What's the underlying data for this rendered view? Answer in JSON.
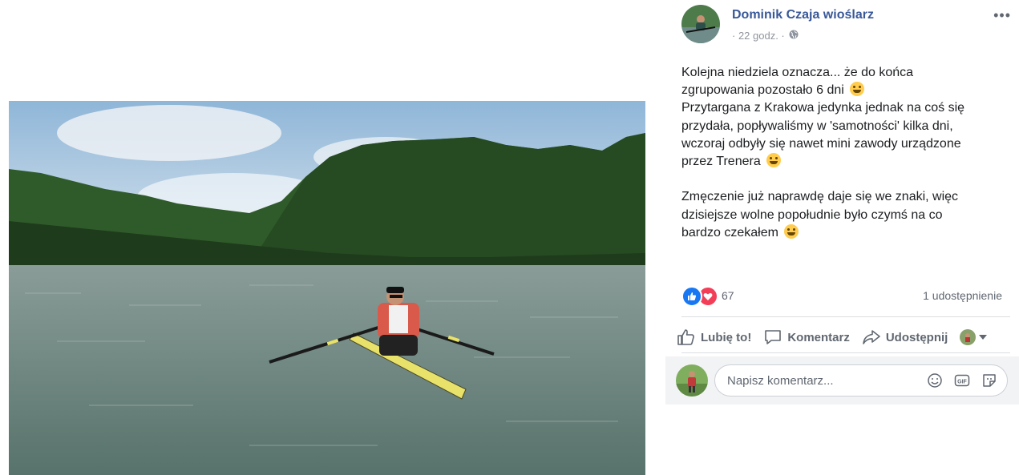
{
  "post": {
    "author": "Dominik Czaja wioślarz",
    "time": "· 22 godz. ·",
    "audience_icon": "globe-icon",
    "more_label": "•••",
    "text": {
      "p1_l1": "Kolejna niedziela oznacza... że do końca",
      "p1_l2": "zgrupowania pozostało 6 dni",
      "p1_l3": "Przytargana z Krakowa jedynka jednak na coś się",
      "p1_l4": "przydała, popływaliśmy w 'samotności' kilka dni,",
      "p1_l5": "wczoraj odbyły się nawet mini zawody urządzone",
      "p1_l6": "przez Trenera",
      "p2_l1": "Zmęczenie już naprawdę daje się we znaki, więc",
      "p2_l2": "dzisiejsze wolne popołudnie było czymś na co",
      "p2_l3": "bardzo czekałem"
    },
    "emojis": [
      "grinning-face-icon",
      "upside-down-face-icon",
      "smiling-face-icon"
    ]
  },
  "stats": {
    "reactions_count": "67",
    "reaction_icons": [
      "like-icon",
      "love-icon"
    ],
    "shares": "1 udostępnienie"
  },
  "actions": {
    "like": "Lubię to!",
    "comment": "Komentarz",
    "share": "Udostępnij"
  },
  "comment": {
    "placeholder": "Napisz komentarz...",
    "icons": [
      "emoji-icon",
      "gif-icon",
      "sticker-icon"
    ]
  },
  "colors": {
    "link": "#385898",
    "text": "#1c1e21",
    "muted": "#606770",
    "like_blue": "#1877f2",
    "love_red": "#f33e58",
    "comment_bg": "#f2f3f5"
  }
}
